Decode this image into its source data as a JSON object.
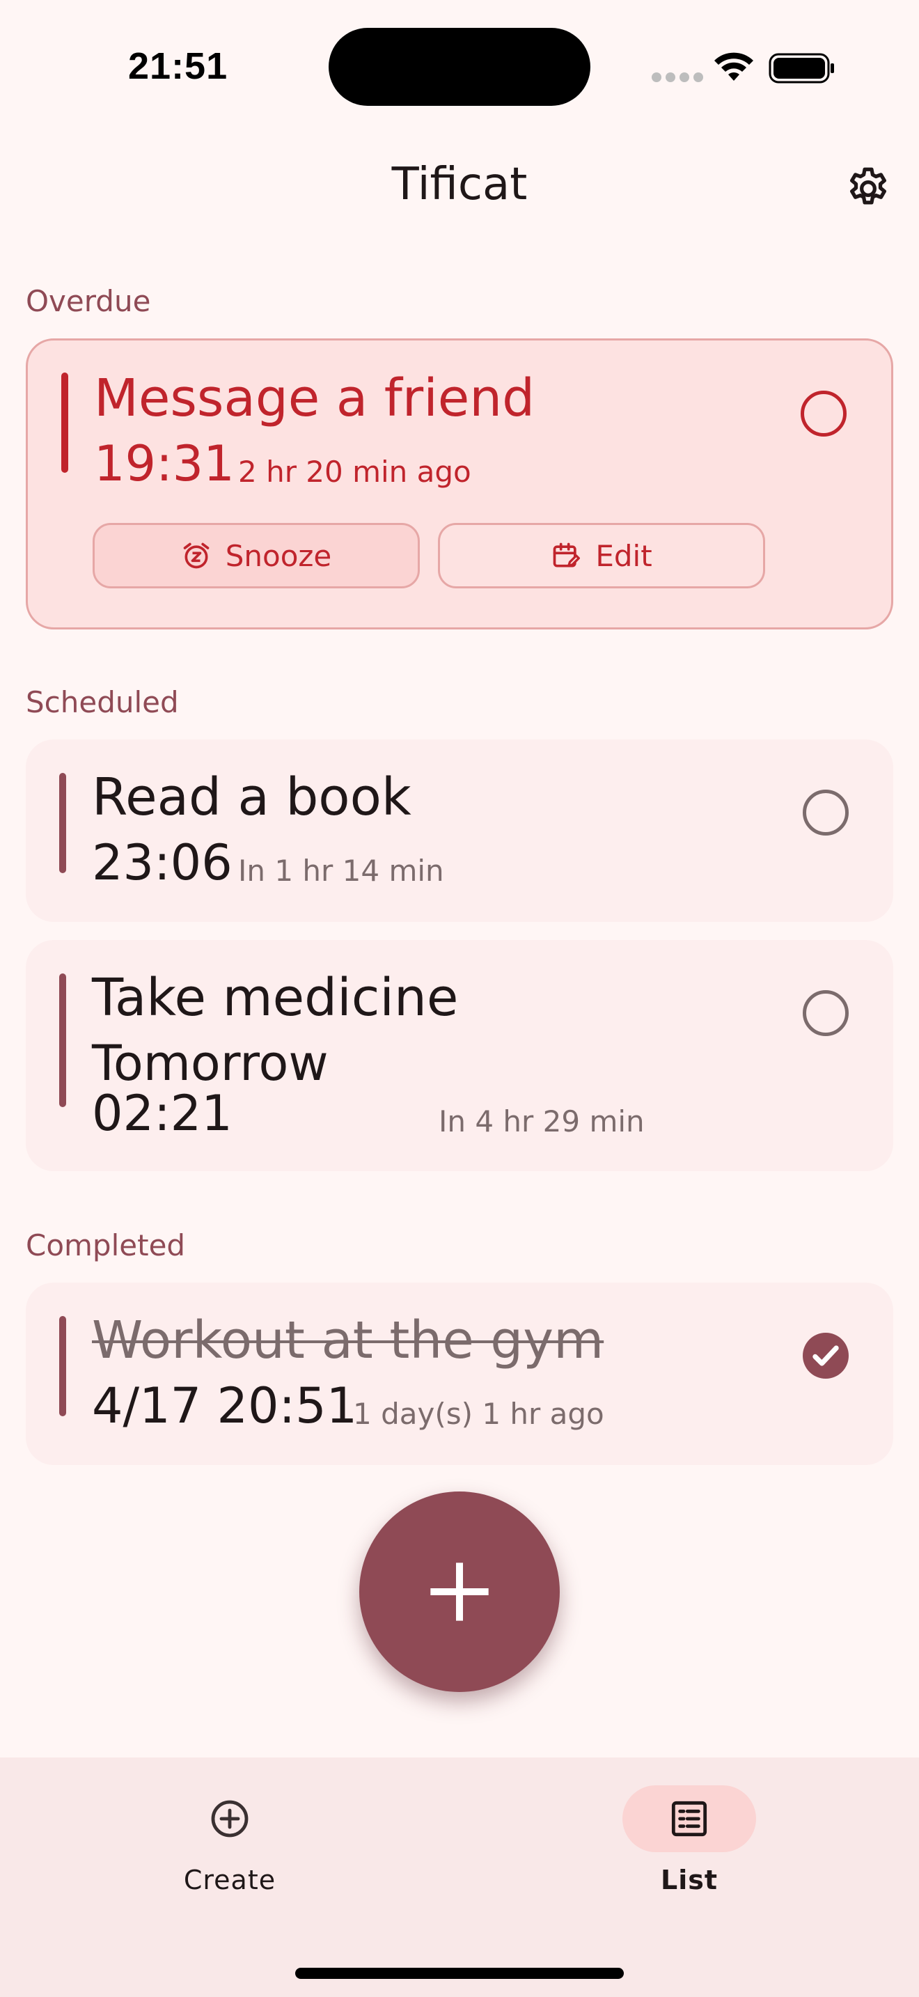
{
  "status_bar": {
    "time": "21:51"
  },
  "header": {
    "title": "Tificat"
  },
  "sections": {
    "overdue": "Overdue",
    "scheduled": "Scheduled",
    "completed": "Completed"
  },
  "overdue_card": {
    "title": "Message a friend",
    "time": "19:31",
    "relative": "2 hr 20 min ago",
    "snooze_label": "Snooze",
    "edit_label": "Edit"
  },
  "scheduled_cards": [
    {
      "title": "Read a book",
      "time": "23:06",
      "relative": "In 1 hr 14 min"
    },
    {
      "title": "Take medicine",
      "day": "Tomorrow",
      "time": "02:21",
      "relative": "In 4 hr 29 min"
    }
  ],
  "completed_card": {
    "title": "Workout at the gym",
    "time": "4/17 20:51",
    "relative": "1 day(s) 1 hr ago"
  },
  "bottom_nav": {
    "create_label": "Create",
    "list_label": "List",
    "active": "List"
  },
  "colors": {
    "accent": "#8f4a55",
    "overdue": "#c0242c",
    "background": "#fff6f5"
  }
}
